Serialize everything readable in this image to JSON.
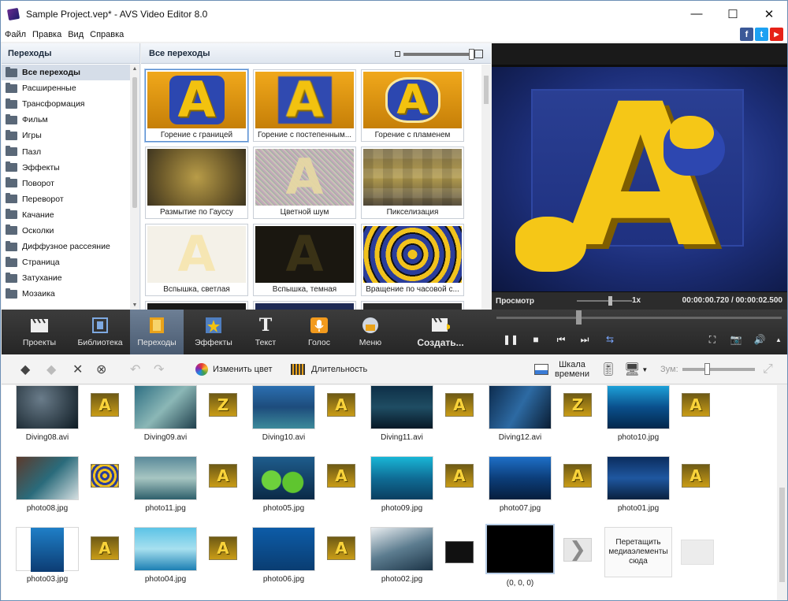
{
  "window": {
    "title": "Sample Project.vep* - AVS Video Editor 8.0",
    "minimize": "—",
    "maximize": "☐",
    "close": "✕"
  },
  "menu": [
    {
      "label": "Файл"
    },
    {
      "label": "Правка"
    },
    {
      "label": "Вид"
    },
    {
      "label": "Справка"
    }
  ],
  "social": {
    "facebook": "f",
    "twitter": "t",
    "youtube": "▶"
  },
  "categories": {
    "title": "Переходы",
    "items": [
      "Все переходы",
      "Расширенные",
      "Трансформация",
      "Фильм",
      "Игры",
      "Пазл",
      "Эффекты",
      "Поворот",
      "Переворот",
      "Качание",
      "Осколки",
      "Диффузное рассеяние",
      "Страница",
      "Затухание",
      "Мозаика"
    ],
    "selected": "Все переходы"
  },
  "transitions": {
    "title": "Все переходы",
    "items": [
      {
        "label": "Горение с границей"
      },
      {
        "label": "Горение с постепенным..."
      },
      {
        "label": "Горение с пламенем"
      },
      {
        "label": "Размытие по Гауссу"
      },
      {
        "label": "Цветной шум"
      },
      {
        "label": "Пикселизация"
      },
      {
        "label": "Вспышка, светлая"
      },
      {
        "label": "Вспышка, темная"
      },
      {
        "label": "Вращение по часовой с..."
      }
    ]
  },
  "preview": {
    "label": "Просмотр",
    "speed": "1x",
    "time": "00:00:00.720 / 00:00:02.500",
    "big_letter": "A"
  },
  "toolbar": {
    "projects": "Проекты",
    "library": "Библиотека",
    "transitions": "Переходы",
    "effects": "Эффекты",
    "text": "Текст",
    "voice": "Голос",
    "menu": "Меню",
    "create": "Создать...",
    "text_icon_glyph": "T"
  },
  "subtoolbar": {
    "change_color": "Изменить цвет",
    "duration": "Длительность",
    "timeline_line1": "Шкала",
    "timeline_line2": "времени",
    "zoom": "Зум:"
  },
  "storyboard": {
    "row1": [
      "Diving08.avi",
      "Diving09.avi",
      "Diving10.avi",
      "Diving11.avi",
      "Diving12.avi",
      "photo10.jpg"
    ],
    "row2": [
      "photo08.jpg",
      "photo11.jpg",
      "photo05.jpg",
      "photo09.jpg",
      "photo07.jpg",
      "photo01.jpg"
    ],
    "row3": [
      "photo03.jpg",
      "photo04.jpg",
      "photo06.jpg",
      "photo02.jpg",
      "(0, 0, 0)"
    ],
    "drop_hint": "Перетащить медиаэлементы сюда",
    "transition_letter": "A",
    "transition_letter_alt": "Z"
  }
}
